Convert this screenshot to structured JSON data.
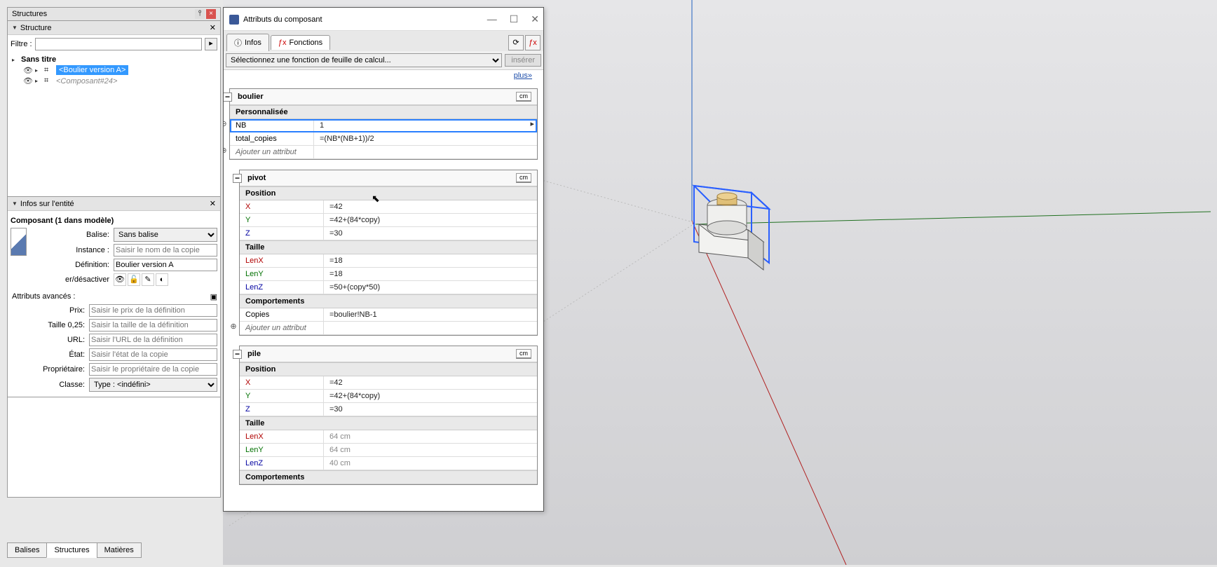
{
  "structures_panel": {
    "title": "Structures",
    "section": "Structure",
    "filter_label": "Filtre :",
    "tree": [
      {
        "label": "Sans titre",
        "bold": true
      },
      {
        "label": "<Boulier version A>",
        "selected": true
      },
      {
        "label": "<Composant#24>",
        "italic": true
      }
    ]
  },
  "entity_panel": {
    "title": "Infos sur l'entité",
    "header": "Composant (1 dans modèle)",
    "fields": {
      "balise_label": "Balise:",
      "balise_value": "Sans balise",
      "instance_label": "Instance :",
      "instance_placeholder": "Saisir le nom de la copie",
      "definition_label": "Définition:",
      "definition_value": "Boulier version A",
      "toggle_label": "er/désactiver"
    },
    "advanced_label": "Attributs avancés :",
    "adv": {
      "prix_label": "Prix:",
      "prix_placeholder": "Saisir le prix de la définition",
      "taille_label": "Taille 0,25:",
      "taille_placeholder": "Saisir la taille de la définition",
      "url_label": "URL:",
      "url_placeholder": "Saisir l'URL de la définition",
      "etat_label": "État:",
      "etat_placeholder": "Saisir l'état de la copie",
      "prop_label": "Propriétaire:",
      "prop_placeholder": "Saisir le propriétaire de la copie",
      "classe_label": "Classe:",
      "classe_value": "Type : <indéfini>"
    }
  },
  "bottom_tabs": [
    "Balises",
    "Structures",
    "Matières"
  ],
  "attr_window": {
    "title": "Attributs du composant",
    "tabs": {
      "infos": "Infos",
      "fonctions": "Fonctions"
    },
    "func_placeholder": "Sélectionnez une fonction de feuille de calcul...",
    "insert_label": "insérer",
    "plus_label": "plus»",
    "blocks": [
      {
        "name": "boulier",
        "unit": "cm",
        "sections": [
          {
            "title": "Personnalisée",
            "rows": [
              {
                "name": "NB",
                "val": "1",
                "selected": true,
                "side_icon": true,
                "left_handle": true
              },
              {
                "name": "total_copies",
                "val": "=(NB*(NB+1))/2"
              }
            ],
            "add": "Ajouter un attribut"
          }
        ]
      },
      {
        "name": "pivot",
        "unit": "cm",
        "indented": true,
        "sections": [
          {
            "title": "Position",
            "rows": [
              {
                "name": "X",
                "val": "=42",
                "cls": "red"
              },
              {
                "name": "Y",
                "val": "=42+(84*copy)",
                "cls": "green"
              },
              {
                "name": "Z",
                "val": "=30",
                "cls": "blue"
              }
            ]
          },
          {
            "title": "Taille",
            "rows": [
              {
                "name": "LenX",
                "val": "=18",
                "cls": "red"
              },
              {
                "name": "LenY",
                "val": "=18",
                "cls": "green"
              },
              {
                "name": "LenZ",
                "val": "=50+(copy*50)",
                "cls": "blue"
              }
            ]
          },
          {
            "title": "Comportements",
            "rows": [
              {
                "name": "Copies",
                "val": "=boulier!NB-1"
              }
            ],
            "add": "Ajouter un attribut"
          }
        ]
      },
      {
        "name": "pile",
        "unit": "cm",
        "indented": true,
        "sections": [
          {
            "title": "Position",
            "rows": [
              {
                "name": "X",
                "val": "=42",
                "cls": "red"
              },
              {
                "name": "Y",
                "val": "=42+(84*copy)",
                "cls": "green"
              },
              {
                "name": "Z",
                "val": "=30",
                "cls": "blue"
              }
            ]
          },
          {
            "title": "Taille",
            "rows": [
              {
                "name": "LenX",
                "val": "64 cm",
                "cls": "red",
                "grey": true
              },
              {
                "name": "LenY",
                "val": "64 cm",
                "cls": "green",
                "grey": true
              },
              {
                "name": "LenZ",
                "val": "40 cm",
                "cls": "blue",
                "grey": true
              }
            ]
          },
          {
            "title": "Comportements",
            "rows": []
          }
        ]
      }
    ]
  }
}
